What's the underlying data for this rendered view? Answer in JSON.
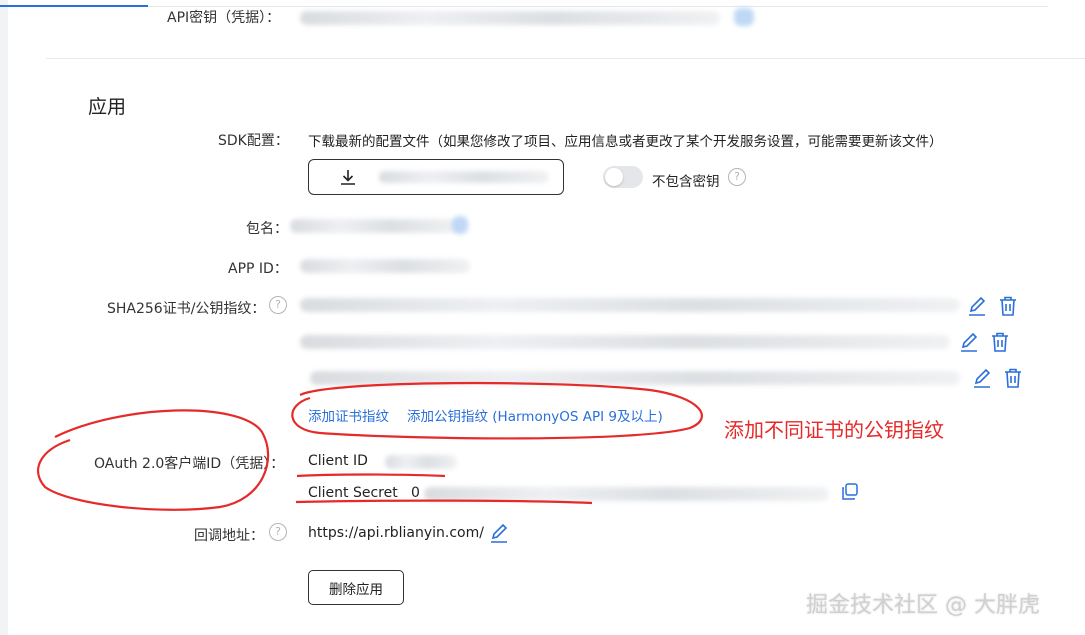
{
  "header": {
    "api_key_label": "API密钥（凭据）："
  },
  "section": {
    "title": "应用"
  },
  "sdk": {
    "label": "SDK配置：",
    "description": "下载最新的配置文件（如果您修改了项目、应用信息或者更改了某个开发服务设置，可能需要更新该文件）",
    "toggle_label": "不包含密钥"
  },
  "package_label": "包名：",
  "app_id_label": "APP ID：",
  "sha_label": "SHA256证书/公钥指纹：",
  "links": {
    "add_cert": "添加证书指纹",
    "add_pubkey": "添加公钥指纹 (HarmonyOS API 9及以上)"
  },
  "oauth": {
    "label": "OAuth 2.0客户端ID（凭据）：",
    "client_id_label": "Client ID",
    "client_secret_label": "Client Secret",
    "client_secret_prefix": "0"
  },
  "callback": {
    "label": "回调地址：",
    "url": "https://api.rblianyin.com/"
  },
  "delete_button": "删除应用",
  "annotation": "添加不同证书的公钥指纹",
  "watermark": "掘金技术社区 @ 大胖虎",
  "colors": {
    "link": "#2a6fdb",
    "annotation": "#e62929"
  },
  "icons": [
    "download-icon",
    "help-icon",
    "edit-icon",
    "trash-icon",
    "copy-icon"
  ]
}
